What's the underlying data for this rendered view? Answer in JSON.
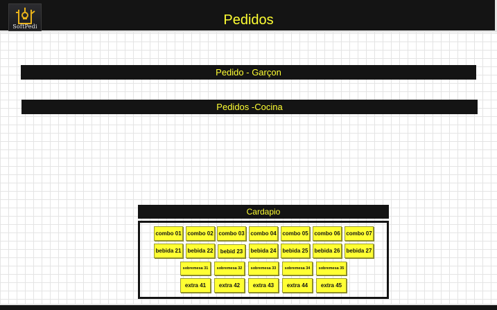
{
  "header": {
    "logo_text": "SoftPedi",
    "title": "Pedidos"
  },
  "sections": {
    "garcon": "Pedido - Garçon",
    "cocina": "Pedidos -Cocina",
    "cardapio": "Cardapio"
  },
  "menu": {
    "combos": [
      "combo 01",
      "combo 02",
      "combo 03",
      "combo 04",
      "combo 05",
      "combo 06",
      "combo 07"
    ],
    "bebidas": [
      "bebida 21",
      "bebida 22",
      "bebid 23",
      "bebida 24",
      "bebida 25",
      "bebida 26",
      "bebida 27"
    ],
    "sobremesas": [
      "sobremesa 31",
      "sobremesa 32",
      "sobremesa 33",
      "sobremesa 34",
      "sobremesa 35"
    ],
    "extras": [
      "extra 41",
      "extra 42",
      "extra 43",
      "extra 44",
      "extra 45"
    ]
  },
  "colors": {
    "accent": "#ffff33",
    "bar": "#141414",
    "button": "#ffff33"
  }
}
